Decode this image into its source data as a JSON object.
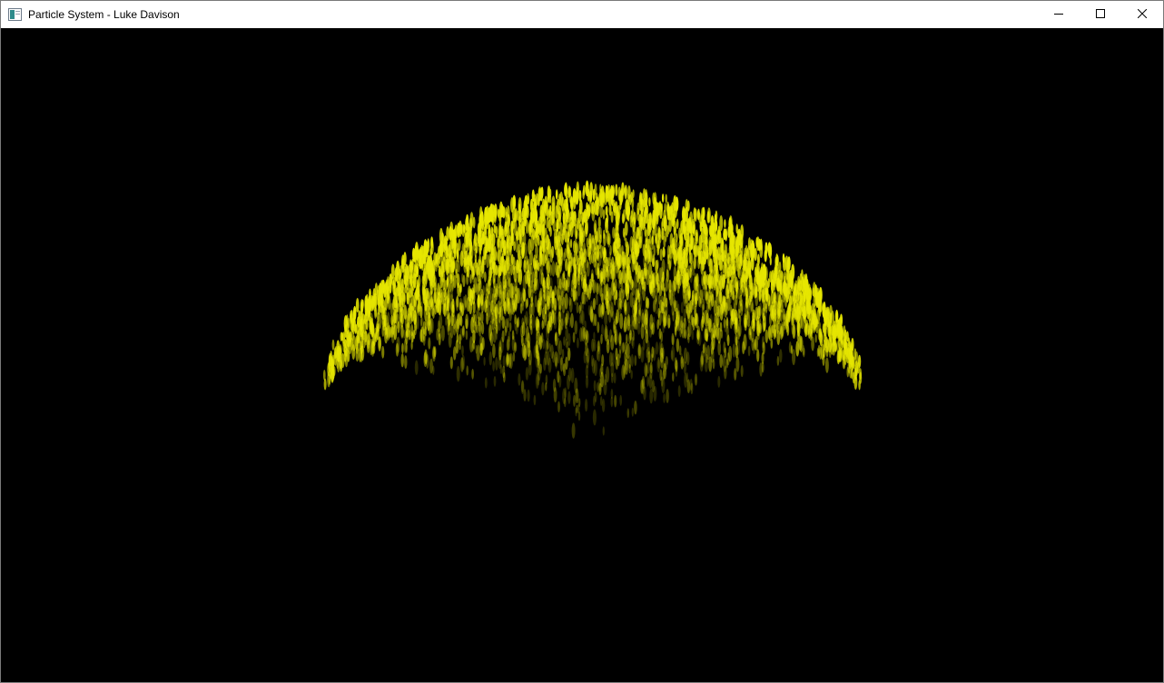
{
  "window": {
    "title": "Particle System - Luke Davison",
    "icon": "application-icon",
    "controls": {
      "minimize": "minimize-icon",
      "maximize": "maximize-icon",
      "close": "close-icon"
    }
  },
  "scene": {
    "background_color": "#000000",
    "particle_color": "#e6e600",
    "particle_shape": "elongated-oval"
  }
}
